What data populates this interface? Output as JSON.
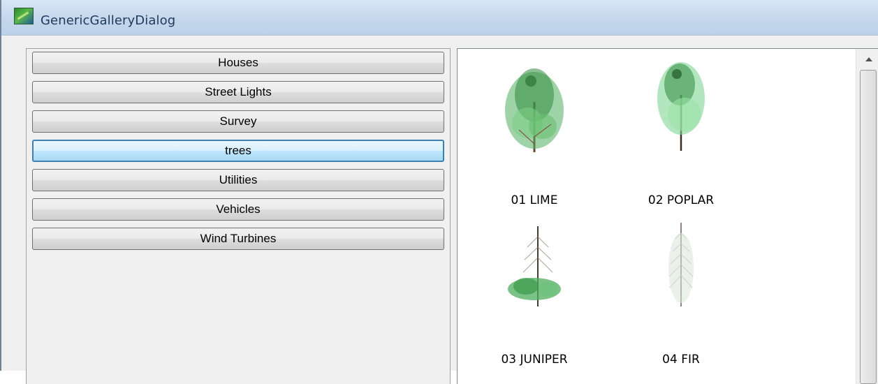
{
  "window": {
    "title": "GenericGalleryDialog",
    "icon": "app-landscape-icon"
  },
  "categories": [
    {
      "label": "Houses",
      "selected": false
    },
    {
      "label": "Street Lights",
      "selected": false
    },
    {
      "label": "Survey",
      "selected": false
    },
    {
      "label": "trees",
      "selected": true
    },
    {
      "label": "Utilities",
      "selected": false
    },
    {
      "label": "Vehicles",
      "selected": false
    },
    {
      "label": "Wind Turbines",
      "selected": false
    }
  ],
  "gallery": {
    "items": [
      {
        "label": "01 LIME",
        "icon": "lime-tree-thumbnail"
      },
      {
        "label": "02 POPLAR",
        "icon": "poplar-tree-thumbnail"
      },
      {
        "label": "03 JUNIPER",
        "icon": "juniper-tree-thumbnail"
      },
      {
        "label": "04 FIR",
        "icon": "fir-tree-thumbnail"
      }
    ]
  },
  "colors": {
    "selected_border": "#3c7fb1",
    "selected_fill": "#bee6fd",
    "foliage_green": "#4fae5f"
  }
}
